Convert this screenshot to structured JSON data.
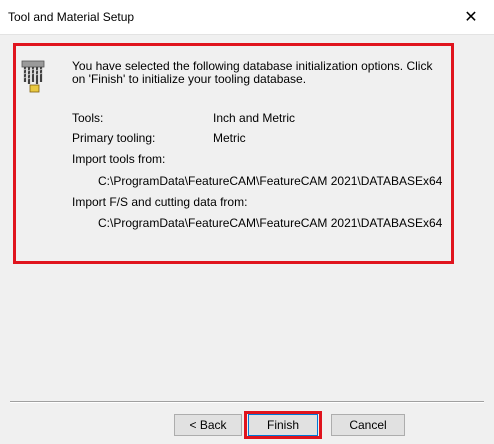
{
  "window": {
    "title": "Tool and Material Setup",
    "close_glyph": "✕"
  },
  "message": "You have selected the following database initialization options.  Click on 'Finish' to initialize your tooling database.",
  "options": {
    "tools_label": "Tools:",
    "tools_value": "Inch and Metric",
    "primary_label": "Primary tooling:",
    "primary_value": "Metric",
    "import_tools_label": "Import tools from:",
    "import_tools_path": "C:\\ProgramData\\FeatureCAM\\FeatureCAM 2021\\DATABASEx64",
    "import_fs_label": "Import F/S and cutting data from:",
    "import_fs_path": "C:\\ProgramData\\FeatureCAM\\FeatureCAM 2021\\DATABASEx64"
  },
  "buttons": {
    "back": "< Back",
    "finish": "Finish",
    "cancel": "Cancel"
  },
  "colors": {
    "highlight": "#e0141e",
    "button_face": "#e1e1e1",
    "dialog_bg": "#f0f0f0"
  },
  "icons": {
    "setup_icon": "tool-rack-icon"
  }
}
